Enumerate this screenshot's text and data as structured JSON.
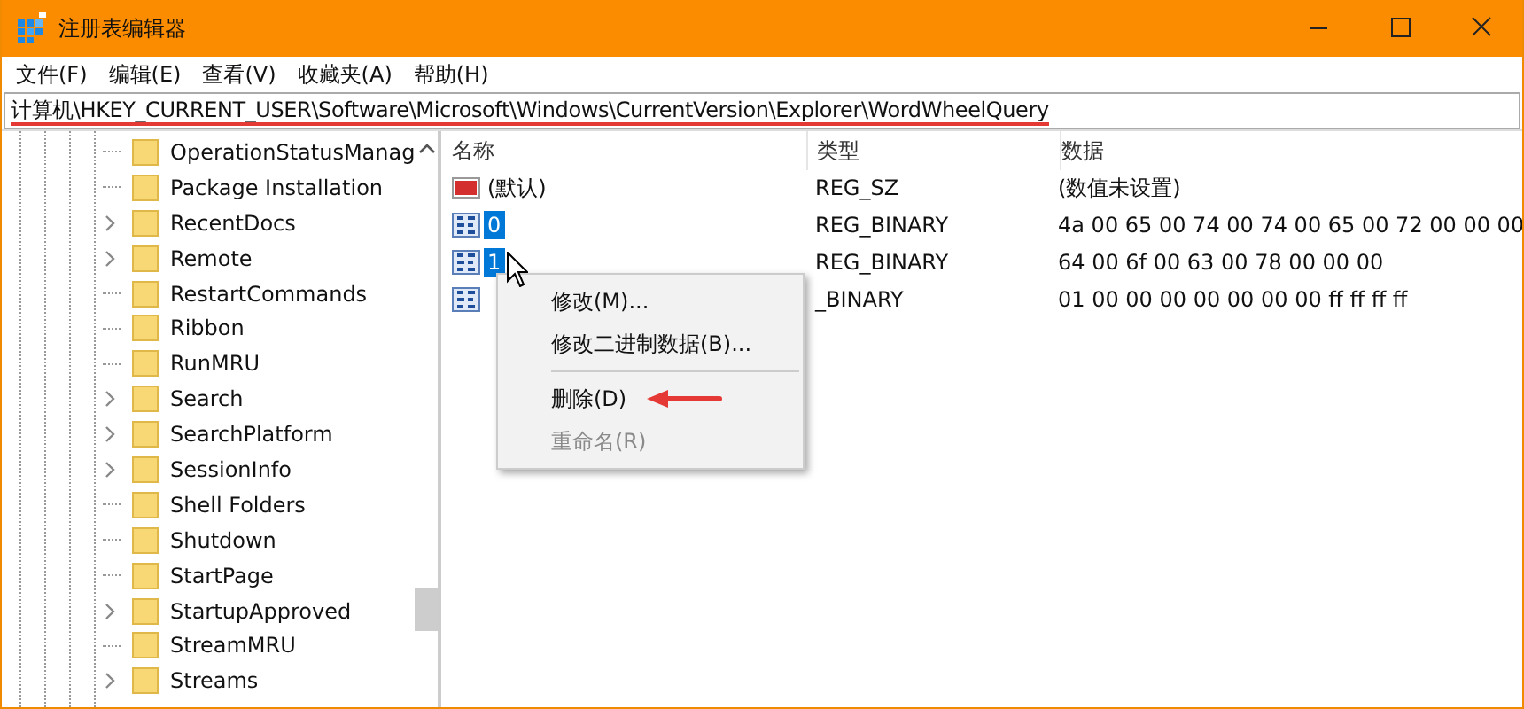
{
  "window": {
    "title": "注册表编辑器"
  },
  "menu": [
    "文件(F)",
    "编辑(E)",
    "查看(V)",
    "收藏夹(A)",
    "帮助(H)"
  ],
  "address": {
    "path": "计算机\\HKEY_CURRENT_USER\\Software\\Microsoft\\Windows\\CurrentVersion\\Explorer\\WordWheelQuery",
    "underlined": true
  },
  "tree": [
    {
      "label": "OperationStatusManag",
      "expandable": false
    },
    {
      "label": "Package Installation",
      "expandable": false
    },
    {
      "label": "RecentDocs",
      "expandable": true
    },
    {
      "label": "Remote",
      "expandable": true
    },
    {
      "label": "RestartCommands",
      "expandable": false
    },
    {
      "label": "Ribbon",
      "expandable": false
    },
    {
      "label": "RunMRU",
      "expandable": false
    },
    {
      "label": "Search",
      "expandable": true
    },
    {
      "label": "SearchPlatform",
      "expandable": true
    },
    {
      "label": "SessionInfo",
      "expandable": true
    },
    {
      "label": "Shell Folders",
      "expandable": false
    },
    {
      "label": "Shutdown",
      "expandable": false
    },
    {
      "label": "StartPage",
      "expandable": false
    },
    {
      "label": "StartupApproved",
      "expandable": true
    },
    {
      "label": "StreamMRU",
      "expandable": false
    },
    {
      "label": "Streams",
      "expandable": true
    }
  ],
  "table": {
    "columns": [
      "名称",
      "类型",
      "数据"
    ],
    "rows": [
      {
        "kind": "string",
        "name": "(默认)",
        "type": "REG_SZ",
        "data": "(数值未设置)",
        "selected": false
      },
      {
        "kind": "binary",
        "name": "0",
        "type": "REG_BINARY",
        "data": "4a 00 65 00 74 00 74 00 65 00 72 00 00 00",
        "selected": true
      },
      {
        "kind": "binary",
        "name": "1",
        "type": "REG_BINARY",
        "data": "64 00 6f 00 63 00 78 00 00 00",
        "selected": true
      },
      {
        "kind": "binary",
        "type": "_BINARY",
        "data": "01 00 00 00 00 00 00 00 ff ff ff ff",
        "selected": false
      }
    ]
  },
  "context_menu": [
    {
      "kind": "item",
      "label": "修改(M)...",
      "disabled": false,
      "pointed": false
    },
    {
      "kind": "item",
      "label": "修改二进制数据(B)...",
      "disabled": false,
      "pointed": false
    },
    {
      "kind": "separator"
    },
    {
      "kind": "item",
      "label": "删除(D)",
      "disabled": false,
      "pointed": true
    },
    {
      "kind": "item",
      "label": "重命名(R)",
      "disabled": true,
      "pointed": false
    }
  ]
}
